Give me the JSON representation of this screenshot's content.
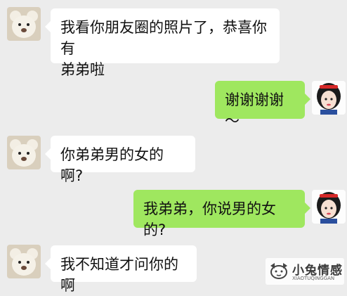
{
  "messages": [
    {
      "side": "left",
      "avatar": "teddy-bear-avatar",
      "text": "我看你朋友圈的照片了，恭喜你有\n弟弟啦"
    },
    {
      "side": "right",
      "avatar": "snow-white-avatar",
      "text": "谢谢谢谢～"
    },
    {
      "side": "left",
      "avatar": "teddy-bear-avatar",
      "text": "你弟弟男的女的啊?"
    },
    {
      "side": "right",
      "avatar": "snow-white-avatar",
      "text": "我弟弟，你说男的女的?"
    },
    {
      "side": "left",
      "avatar": "teddy-bear-avatar",
      "text": "我不知道才问你的啊"
    }
  ],
  "watermark": {
    "title": "小兔情感",
    "subtitle": "XIAOTUQINGGAN"
  },
  "colors": {
    "background": "#ececec",
    "left_bubble": "#ffffff",
    "right_bubble": "#9fe75f"
  }
}
